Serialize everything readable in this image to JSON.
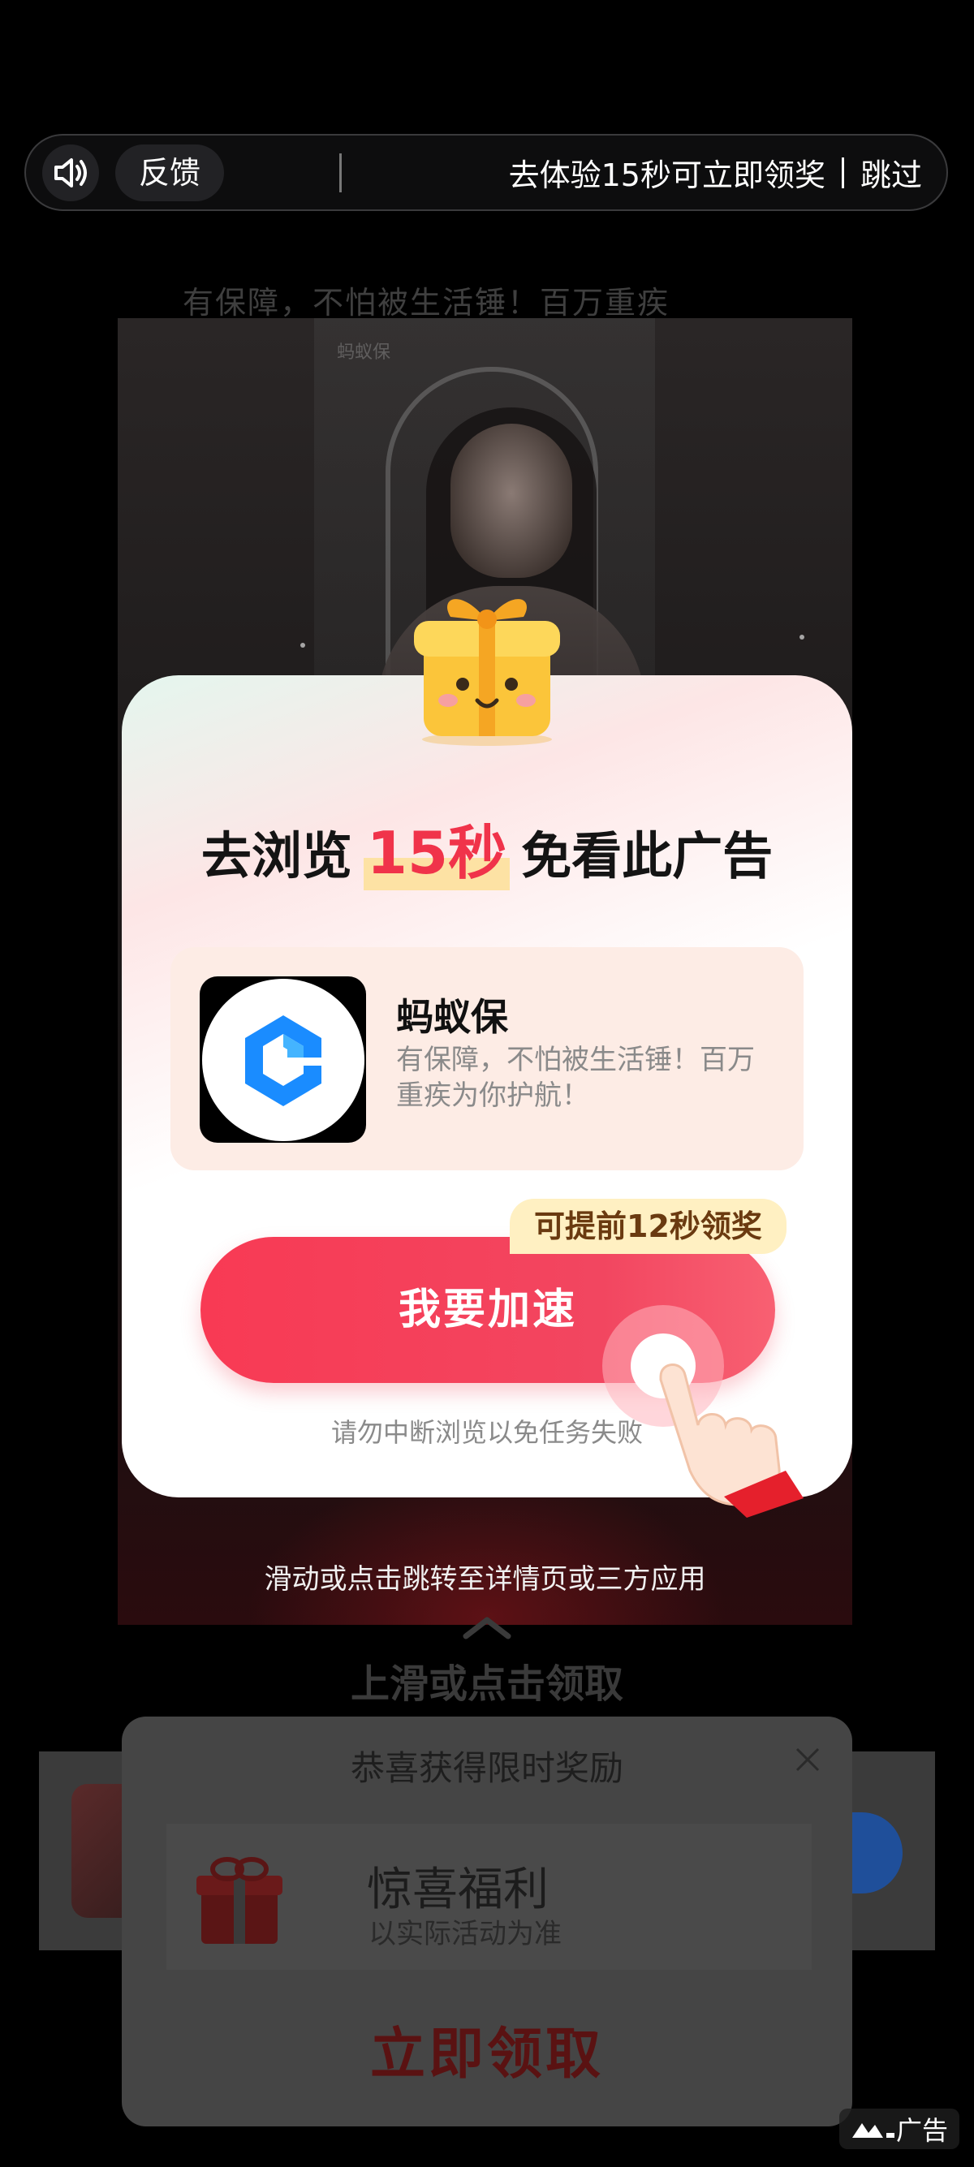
{
  "top_bar": {
    "feedback_label": "反馈",
    "reward_prompt": "去体验15秒可立即领奖",
    "skip_label": "跳过"
  },
  "background": {
    "headline": "有保障，不怕被生活锤！百万重疾",
    "watermark_logo_text": "蚂蚁保",
    "swipe_hint": "滑动或点击跳转至详情页或三方应用",
    "up_slide_text": "上滑或点击领取"
  },
  "dialog": {
    "headline_prefix": "去浏览",
    "headline_number": "15秒",
    "headline_suffix": "免看此广告",
    "app": {
      "name": "蚂蚁保",
      "description": "有保障，不怕被生活锤！百万重疾为你护航！"
    },
    "speed_tag": "可提前12秒领奖",
    "speed_button_label": "我要加速",
    "warning": "请勿中断浏览以免任务失败"
  },
  "reward_card": {
    "title": "恭喜获得限时奖励",
    "item_title": "惊喜福利",
    "item_subtitle": "以实际活动为准",
    "claim_label": "立即领取"
  },
  "ad_label": "广告",
  "colors": {
    "accent_red": "#f0334a",
    "button_gradient_start": "#f83a54",
    "tag_bg": "#fff0c2",
    "app_card_bg": "#fdece5",
    "brand_blue": "#1a8cff"
  }
}
